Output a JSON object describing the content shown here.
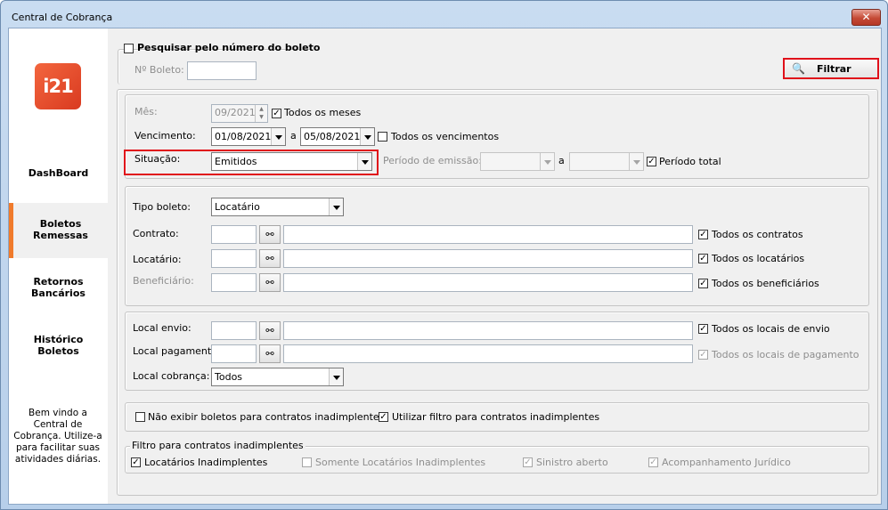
{
  "window": {
    "title": "Central de Cobrança",
    "close_label": "✕"
  },
  "logo_text": "i21",
  "sidebar": {
    "items": [
      {
        "label": "DashBoard"
      },
      {
        "label": "Boletos\nRemessas"
      },
      {
        "label": "Retornos\nBancários"
      },
      {
        "label": "Histórico\nBoletos"
      }
    ],
    "welcome": "Bem vindo a Central de Cobrança. Utilize-a para facilitar suas atividades diárias."
  },
  "search_boleto": {
    "checkbox_label": "Pesquisar pelo número do boleto",
    "field_label": "Nº Boleto:",
    "value": ""
  },
  "filter_button": "Filtrar",
  "period": {
    "mes_label": "Mês:",
    "mes_value": "09/2021",
    "todos_meses": "Todos os meses",
    "vencimento_label": "Vencimento:",
    "venc_from": "01/08/2021",
    "venc_sep": "a",
    "venc_to": "05/08/2021",
    "todos_vencimentos": "Todos os vencimentos",
    "situacao_label": "Situação:",
    "situacao_value": "Emitidos",
    "periodo_emissao_label": "Período de emissão:",
    "emissao_sep": "a",
    "periodo_total": "Período total"
  },
  "contracts": {
    "tipo_label": "Tipo boleto:",
    "tipo_value": "Locatário",
    "contrato_label": "Contrato:",
    "todos_contratos": "Todos os contratos",
    "locatario_label": "Locatário:",
    "todos_locatarios": "Todos os locatários",
    "beneficiario_label": "Beneficiário:",
    "todos_beneficiarios": "Todos os beneficiários"
  },
  "local": {
    "envio_label": "Local envio:",
    "todos_envio": "Todos os locais de envio",
    "pagamento_label": "Local pagamento",
    "todos_pagamento": "Todos os locais de pagamento",
    "cobranca_label": "Local cobrança:",
    "cobranca_value": "Todos"
  },
  "options": {
    "nao_exibir": "Não exibir boletos para contratos inadimplentes",
    "utilizar_filtro": "Utilizar filtro para contratos inadimplentes"
  },
  "inadimplentes": {
    "group_label": "Filtro para contratos inadimplentes",
    "locatarios": "Locatários Inadimplentes",
    "somente": "Somente Locatários Inadimplentes",
    "sinistro": "Sinistro aberto",
    "acompanhamento": "Acompanhamento Jurídico"
  },
  "colors": {
    "accent": "#f07b2c",
    "highlight": "#e0101a",
    "logo": "#e5492b"
  }
}
